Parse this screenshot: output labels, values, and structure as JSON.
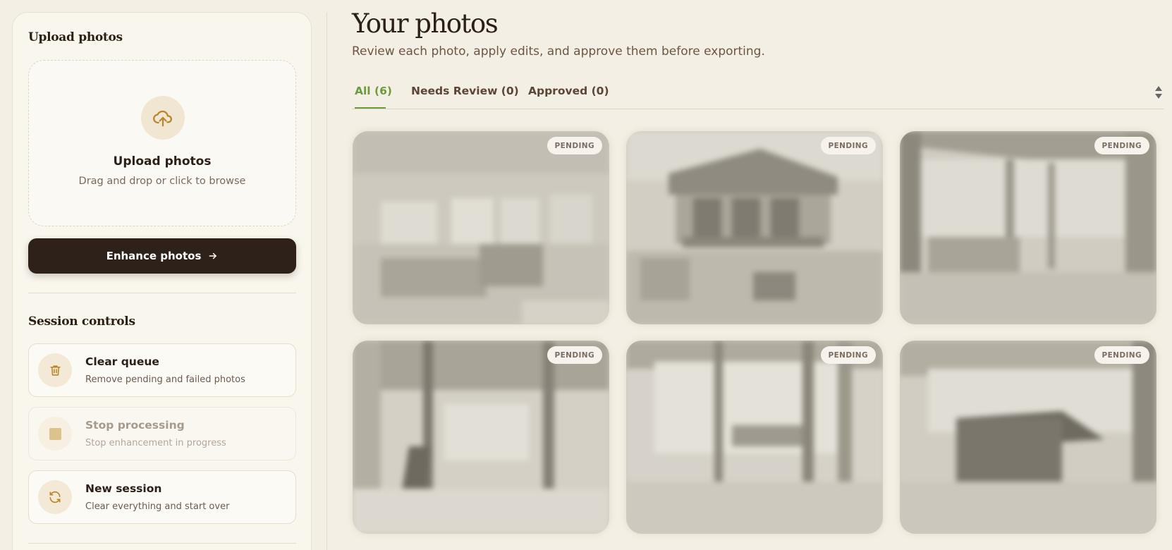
{
  "sidebar": {
    "upload_section_title": "Upload photos",
    "dropzone": {
      "title": "Upload photos",
      "subtitle": "Drag and drop or click to browse",
      "icon": "cloud-upload-icon"
    },
    "enhance_button": {
      "label": "Enhance photos",
      "icon": "arrow-right-icon"
    },
    "session_title": "Session controls",
    "controls": [
      {
        "title": "Clear queue",
        "subtitle": "Remove pending and failed photos",
        "icon": "trash-icon",
        "enabled": true
      },
      {
        "title": "Stop processing",
        "subtitle": "Stop enhancement in progress",
        "icon": "stop-icon",
        "enabled": false
      },
      {
        "title": "New session",
        "subtitle": "Clear everything and start over",
        "icon": "refresh-icon",
        "enabled": true
      }
    ]
  },
  "main": {
    "title": "Your photos",
    "subtitle": "Review each photo, apply edits, and approve them before exporting.",
    "tabs": [
      {
        "label": "All (6)",
        "active": true
      },
      {
        "label": "Needs Review (0)",
        "active": false
      },
      {
        "label": "Approved (0)",
        "active": false
      }
    ],
    "photos": [
      {
        "status": "PENDING",
        "scene": "living-room"
      },
      {
        "status": "PENDING",
        "scene": "cabin-exterior"
      },
      {
        "status": "PENDING",
        "scene": "porch"
      },
      {
        "status": "PENDING",
        "scene": "interior-beams"
      },
      {
        "status": "PENDING",
        "scene": "window-chairs"
      },
      {
        "status": "PENDING",
        "scene": "dining-table"
      }
    ]
  },
  "colors": {
    "background": "#f4efe4",
    "accent_green": "#6e9a3e",
    "button_dark": "#2e2119",
    "icon_gold": "#b8862b"
  }
}
